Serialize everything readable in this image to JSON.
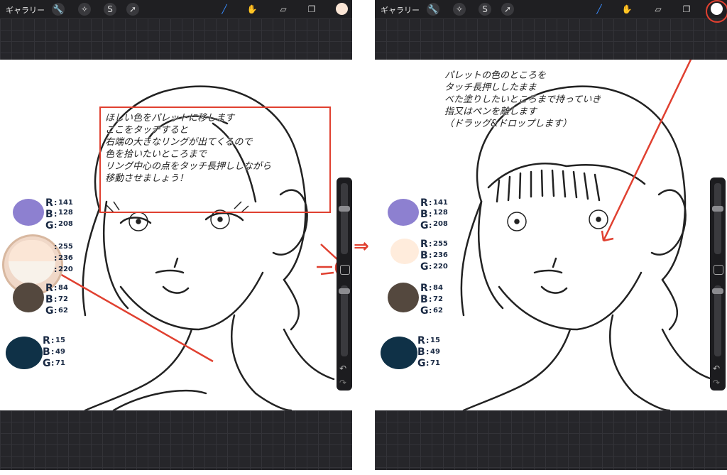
{
  "toolbar": {
    "gallery_label": "ギャラリー",
    "icons": [
      "wrench-icon",
      "magic-wand-icon",
      "selection-icon",
      "transform-icon",
      "brush-icon",
      "smudge-icon",
      "eraser-icon",
      "layers-icon",
      "color-swatch"
    ]
  },
  "colors": {
    "accent_red": "#e04030",
    "current_color_left": "#fbe6d6",
    "current_color_right": "#ffffff"
  },
  "swatches": [
    {
      "hex": "#8d80d0",
      "r_label": "R",
      "b_label": "B",
      "g_label": "G",
      "r": "141",
      "b": "128",
      "g": "208"
    },
    {
      "hex": "#ffecdc",
      "r_label": "R",
      "b_label": "B",
      "g_label": "G",
      "r": "255",
      "b": "236",
      "g": "220"
    },
    {
      "hex": "#54483e",
      "r_label": "R",
      "b_label": "B",
      "g_label": "G",
      "r": "84",
      "b": "72",
      "g": "62"
    },
    {
      "hex": "#0f3147",
      "r_label": "R",
      "b_label": "B",
      "g_label": "G",
      "r": "15",
      "b": "49",
      "g": "71"
    }
  ],
  "left_note": "ほしい色をパレットに移します\nここをタッチすると\n右端の大きなリングが出てくるので\n色を拾いたいところまで\nリング中心の点をタッチ長押ししながら\n移動させましょう！",
  "right_note": "パレットの色のところを\nタッチ長押ししたまま\nべた塗りしたいところまで持っていき\n指又はペンを離します\n（ドラッグ&ドロップします）",
  "between_arrow": "⇒"
}
